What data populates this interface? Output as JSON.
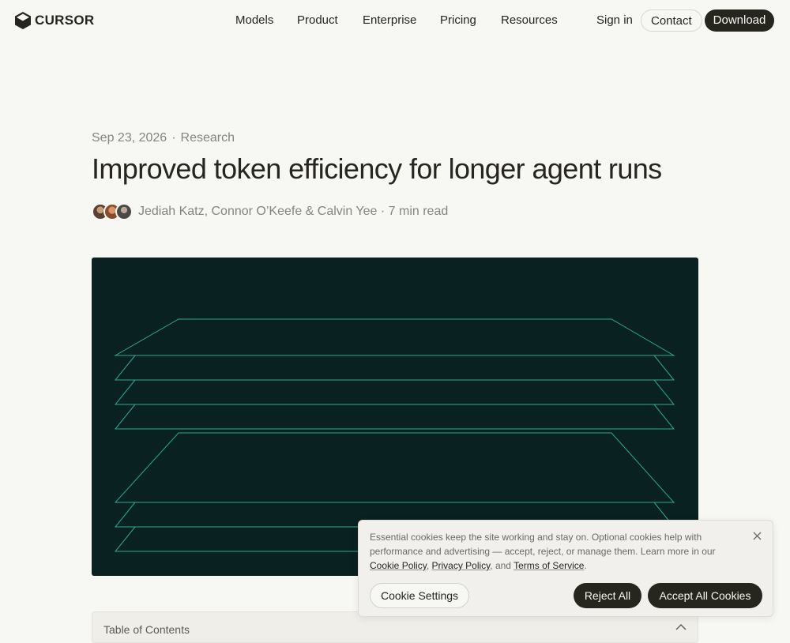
{
  "nav": {
    "logo_text": "CURSOR",
    "links": [
      "Models",
      "Product",
      "Enterprise",
      "Pricing",
      "Resources"
    ],
    "signin_label": "Sign in",
    "contact_label": "Contact",
    "download_label": "Download"
  },
  "article": {
    "date": "Sep 23, 2026",
    "separator": "·",
    "category": "Research",
    "title": "Improved token efficiency for longer agent runs",
    "authors": "Jediah Katz, Connor O’Keefe & Calvin Yee",
    "read_time": "· 7 min read"
  },
  "hero": {
    "background_color": "#092221",
    "line_color": "#2aa890",
    "icon": "stacked-layers-illustration"
  },
  "toc": {
    "label": "Table of Contents",
    "icon": "chevron-up-icon"
  },
  "cookie": {
    "text_before": "Essential cookies keep the site working and stay on. Optional cookies help with performance and advertising — accept, reject, or manage them. Learn more in our ",
    "link_cookie_policy": "Cookie Policy",
    "comma": ", ",
    "link_privacy_policy": "Privacy Policy",
    "and_text": ", and ",
    "link_terms": "Terms of Service",
    "period": ".",
    "settings_label": "Cookie Settings",
    "reject_label": "Reject All",
    "accept_label": "Accept All Cookies",
    "close_icon": "close-icon"
  },
  "colors": {
    "background": "#f7f7f4",
    "text": "#26251e",
    "muted": "#85847e",
    "button_dark": "#26251e"
  }
}
